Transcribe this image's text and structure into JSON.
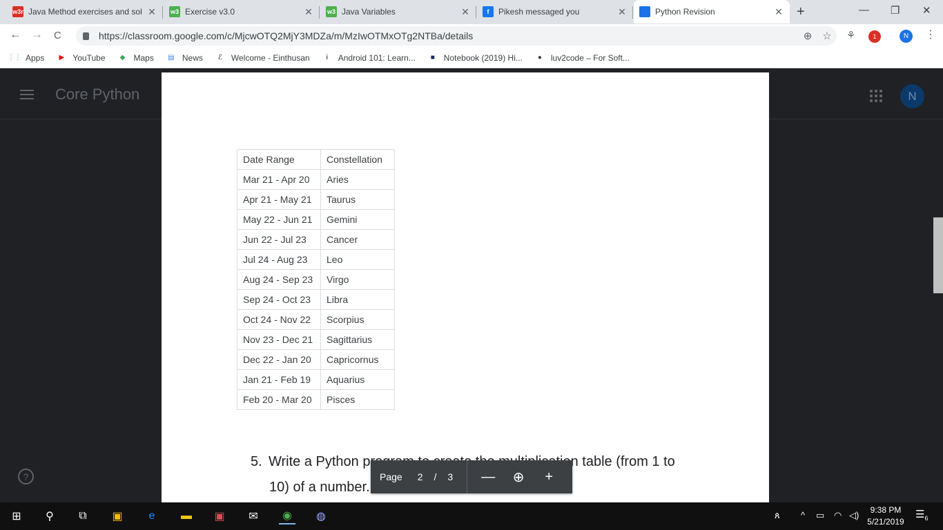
{
  "tabs": [
    {
      "title": "Java Method exercises and sol",
      "icon": "w3resource-icon",
      "favicon_text": "w3r",
      "active": false
    },
    {
      "title": "Exercise v3.0",
      "icon": "w3schools-icon",
      "favicon_text": "w3",
      "active": false
    },
    {
      "title": "Java Variables",
      "icon": "w3schools-icon",
      "favicon_text": "w3",
      "active": false
    },
    {
      "title": "Pikesh messaged you",
      "icon": "facebook-icon",
      "favicon_text": "f",
      "active": false
    },
    {
      "title": "Python Revision",
      "icon": "classroom-icon",
      "favicon_text": "",
      "active": true
    }
  ],
  "tab_close_glyph": "✕",
  "new_tab_glyph": "+",
  "window_controls": {
    "minimize": "—",
    "restore": "❐",
    "close": "✕"
  },
  "toolbar": {
    "back": "←",
    "forward": "→",
    "reload": "C",
    "url": "https://classroom.google.com/c/MjcwOTQ2MjY3MDZa/m/MzIwOTMxOTg2NTBa/details",
    "zoom_glyph": "⊕",
    "star_glyph": "☆",
    "ext_badge": "1",
    "profile_initial": "N",
    "menu_glyph": "⋮"
  },
  "bookmarks": [
    {
      "label": "Apps",
      "icon": "apps-grid-icon",
      "glyph": "⋮⋮",
      "color": "#1a73e8"
    },
    {
      "label": "YouTube",
      "icon": "youtube-icon",
      "glyph": "▶",
      "color": "#ff0000"
    },
    {
      "label": "Maps",
      "icon": "maps-icon",
      "glyph": "◆",
      "color": "#34a853"
    },
    {
      "label": "News",
      "icon": "news-icon",
      "glyph": "▤",
      "color": "#4285f4"
    },
    {
      "label": "Welcome - Einthusan",
      "icon": "einthusan-icon",
      "glyph": "ℰ",
      "color": "#000000"
    },
    {
      "label": "Android 101: Learn...",
      "icon": "info-icon",
      "glyph": "i",
      "color": "#000000"
    },
    {
      "label": "Notebook (2019) Hi...",
      "icon": "notebook-icon",
      "glyph": "■",
      "color": "#1a2a5a"
    },
    {
      "label": "luv2code – For Soft...",
      "icon": "globe-icon",
      "glyph": "●",
      "color": "#3c4043"
    }
  ],
  "appbar": {
    "course_title": "Core Python",
    "user_initial": "N"
  },
  "zodiac_table": {
    "headers": [
      "Date Range",
      "Constellation"
    ],
    "rows": [
      [
        "Mar 21 - Apr 20",
        "Aries"
      ],
      [
        "Apr 21 - May 21",
        "Taurus"
      ],
      [
        "May 22 - Jun 21",
        "Gemini"
      ],
      [
        "Jun 22 - Jul 23",
        "Cancer"
      ],
      [
        "Jul 24 - Aug 23",
        "Leo"
      ],
      [
        "Aug 24 - Sep 23",
        "Virgo"
      ],
      [
        "Sep 24 - Oct 23",
        "Libra"
      ],
      [
        "Oct 24 - Nov 22",
        "Scorpius"
      ],
      [
        "Nov 23 - Dec 21",
        "Sagittarius"
      ],
      [
        "Dec 22 - Jan 20",
        "Capricornus"
      ],
      [
        "Jan 21 - Feb 19",
        "Aquarius"
      ],
      [
        "Feb 20 - Mar 20",
        "Pisces"
      ]
    ]
  },
  "question": {
    "number": "5.",
    "line1": "Write a Python program to create the multiplication table (from 1 to",
    "line2": "10) of a number."
  },
  "pager": {
    "label": "Page",
    "current": "2",
    "separator": "/",
    "total": "3",
    "zoom_out": "—",
    "zoom_in": "+",
    "zoom_icon": "⊕"
  },
  "help_glyph": "?",
  "taskbar": {
    "time": "9:38 PM",
    "date": "5/21/2019",
    "notification_count": "6",
    "apps": [
      {
        "icon": "windows-start-icon",
        "glyph": "⊞",
        "color": "#ffffff"
      },
      {
        "icon": "search-icon",
        "glyph": "⚲",
        "color": "#ffffff"
      },
      {
        "icon": "task-view-icon",
        "glyph": "⧉",
        "color": "#ffffff"
      },
      {
        "icon": "store-icon",
        "glyph": "▣",
        "color": "#ffb900"
      },
      {
        "icon": "edge-icon",
        "glyph": "e",
        "color": "#1e90ff"
      },
      {
        "icon": "file-explorer-icon",
        "glyph": "▬",
        "color": "#f2c811"
      },
      {
        "icon": "office-icon",
        "glyph": "▣",
        "color": "#e74856"
      },
      {
        "icon": "mail-icon",
        "glyph": "✉",
        "color": "#ffffff"
      },
      {
        "icon": "chrome-icon",
        "glyph": "◉",
        "color": "#4caf50"
      },
      {
        "icon": "visual-studio-icon",
        "glyph": "◍",
        "color": "#9ea6ff"
      }
    ],
    "tray_icons": [
      {
        "icon": "people-icon",
        "glyph": "ጰ"
      },
      {
        "icon": "chevron-up-icon",
        "glyph": "^"
      },
      {
        "icon": "battery-icon",
        "glyph": "▭"
      },
      {
        "icon": "wifi-icon",
        "glyph": "◠"
      },
      {
        "icon": "volume-icon",
        "glyph": "◁)"
      }
    ]
  }
}
